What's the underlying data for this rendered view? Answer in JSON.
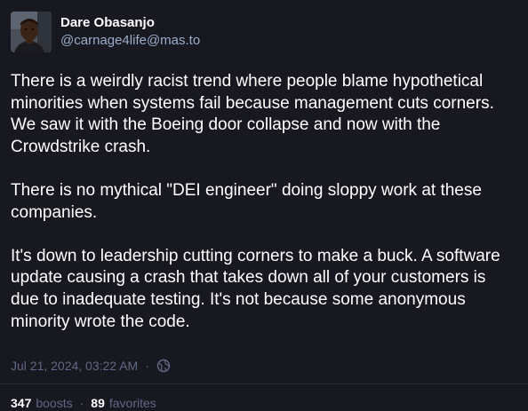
{
  "author": {
    "display_name": "Dare Obasanjo",
    "handle": "@carnage4life@mas.to",
    "avatar_icon": "profile-photo"
  },
  "post": {
    "paragraphs": [
      "There is a weirdly racist trend where people blame hypothetical minorities when systems fail because management cuts corners. We saw it with the Boeing door collapse and now with the Crowdstrike crash.",
      "There is no mythical \"DEI engineer\" doing sloppy work at these companies.",
      "It's down to leadership cutting corners to make a buck. A software update causing a crash that takes down all of your customers is due to inadequate testing. It's not because some anonymous minority wrote the code."
    ],
    "timestamp": "Jul 21, 2024, 03:22 AM",
    "separator": "·",
    "visibility_icon": "globe-icon"
  },
  "stats": {
    "boosts_count": "347",
    "boosts_label": "boosts",
    "favorites_count": "89",
    "favorites_label": "favorites",
    "separator": "·"
  },
  "colors": {
    "background": "#181821",
    "text": "#ffffff",
    "secondary_text": "#9baec8",
    "muted_text": "#606984",
    "divider": "#282c37"
  }
}
